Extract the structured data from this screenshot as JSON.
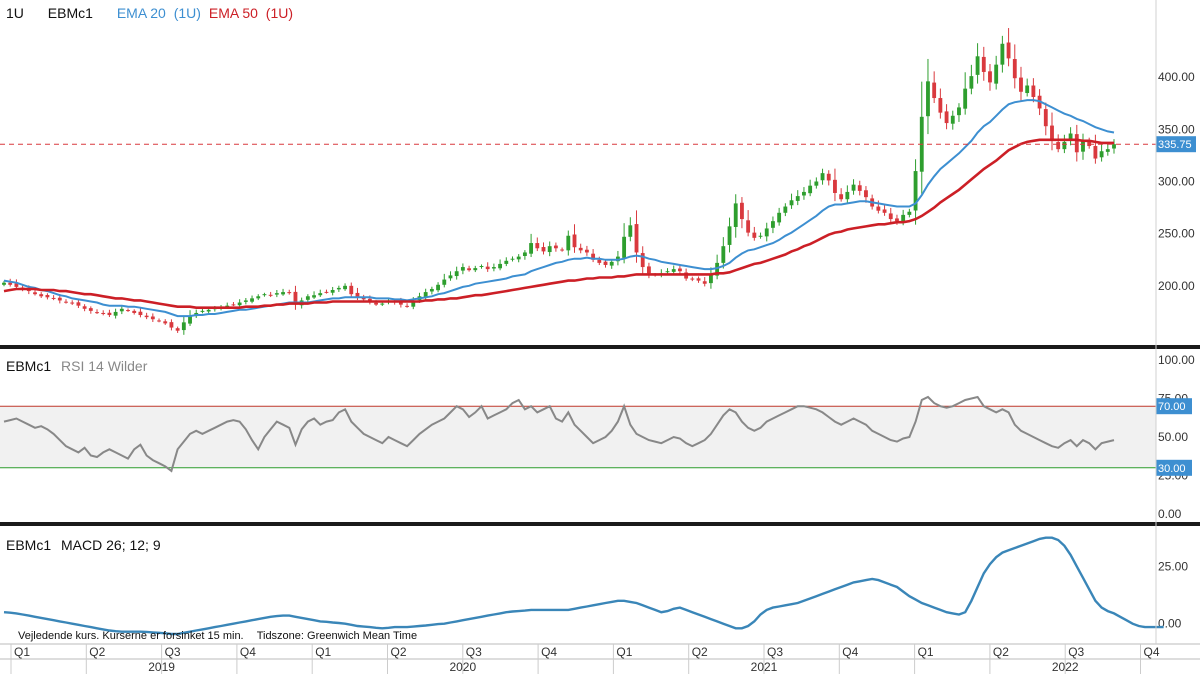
{
  "header": {
    "interval": "1U",
    "symbol": "EBMc1",
    "ema20_label": "EMA 20",
    "ema20_interval": "(1U)",
    "ema50_label": "EMA 50",
    "ema50_interval": "(1U)"
  },
  "rsi_header": {
    "symbol": "EBMc1",
    "label": "RSI 14 Wilder"
  },
  "macd_header": {
    "symbol": "EBMc1",
    "label": "MACD 26; 12; 9"
  },
  "disclaimer": "Vejledende kurs. Kurserne er forsinket 15 min.",
  "timezone": "Tidszone: Greenwich Mean Time",
  "colors": {
    "up": "#2e9e2e",
    "down": "#d9393e",
    "ema20": "#3d8fd1",
    "ema50": "#cc1f26",
    "rsi": "#888888",
    "macd": "#3a86b8",
    "band": "#f1f1f1",
    "rsi_upper": "#c0392b",
    "rsi_lower": "#2e9e2e",
    "last_price_box": "#3d8fd1"
  },
  "chart_data": [
    {
      "type": "candlestick",
      "ylim": [
        150,
        450
      ],
      "yticks": [
        "400.00",
        "350.00",
        "300.00",
        "250.00",
        "200.00"
      ],
      "ytick_values": [
        400,
        350,
        300,
        250,
        200
      ],
      "last_price": 335.75,
      "last_price_label": "335.75",
      "close": [
        203,
        201,
        199,
        197,
        195,
        192,
        190,
        189,
        188,
        186,
        184,
        183,
        181,
        178,
        176,
        174,
        173,
        172,
        175,
        178,
        176,
        174,
        172,
        170,
        168,
        166,
        164,
        160,
        157,
        165,
        171,
        174,
        176,
        177,
        179,
        180,
        181,
        182,
        184,
        186,
        188,
        190,
        192,
        191,
        193,
        194,
        193,
        182,
        186,
        190,
        191,
        193,
        194,
        196,
        198,
        200,
        192,
        189,
        187,
        185,
        182,
        183,
        186,
        184,
        182,
        180,
        185,
        190,
        194,
        197,
        201,
        206,
        210,
        214,
        218,
        215,
        217,
        219,
        216,
        218,
        221,
        224,
        226,
        228,
        232,
        241,
        236,
        233,
        238,
        236,
        234,
        248,
        237,
        234,
        232,
        225,
        222,
        220,
        223,
        228,
        247,
        258,
        232,
        218,
        212,
        210,
        212,
        214,
        216,
        214,
        207,
        206,
        205,
        202,
        211,
        222,
        238,
        257,
        279,
        264,
        251,
        246,
        248,
        255,
        262,
        270,
        276,
        282,
        286,
        290,
        296,
        300,
        308,
        301,
        289,
        283,
        290,
        297,
        291,
        285,
        276,
        272,
        270,
        264,
        262,
        268,
        271,
        310,
        362,
        396,
        380,
        366,
        356,
        363,
        371,
        389,
        401,
        420,
        405,
        395,
        412,
        432,
        418,
        399,
        386,
        392,
        381,
        370,
        353,
        339,
        331,
        338,
        346,
        328,
        340,
        334,
        322,
        329,
        331,
        335.75
      ],
      "series": [
        {
          "name": "EMA 20",
          "values": [
            205,
            204,
            203,
            201,
            199,
            198,
            196,
            195,
            193,
            191,
            190,
            188,
            187,
            186,
            185,
            184,
            182,
            181,
            181,
            181,
            180,
            180,
            179,
            178,
            177,
            176,
            175,
            173,
            171,
            171,
            171,
            172,
            172,
            173,
            173,
            174,
            175,
            176,
            177,
            177,
            178,
            179,
            180,
            181,
            182,
            183,
            184,
            184,
            184,
            184,
            185,
            186,
            187,
            188,
            188,
            189,
            189,
            189,
            189,
            189,
            188,
            188,
            188,
            187,
            187,
            186,
            187,
            188,
            189,
            190,
            192,
            193,
            195,
            197,
            199,
            200,
            202,
            203,
            204,
            205,
            206,
            207,
            209,
            210,
            211,
            214,
            216,
            218,
            220,
            222,
            223,
            225,
            226,
            226,
            227,
            226,
            226,
            225,
            225,
            225,
            226,
            228,
            229,
            228,
            226,
            225,
            223,
            222,
            221,
            220,
            219,
            218,
            217,
            216,
            216,
            217,
            219,
            222,
            227,
            231,
            234,
            235,
            237,
            239,
            241,
            244,
            248,
            251,
            255,
            259,
            263,
            267,
            272,
            276,
            278,
            278,
            279,
            280,
            281,
            281,
            280,
            279,
            278,
            277,
            276,
            276,
            276,
            279,
            287,
            297,
            305,
            312,
            317,
            322,
            327,
            333,
            339,
            347,
            353,
            357,
            363,
            369,
            374,
            376,
            377,
            378,
            378,
            377,
            374,
            371,
            368,
            365,
            363,
            360,
            358,
            355,
            352,
            350,
            348,
            347
          ]
        },
        {
          "name": "EMA 50",
          "values": [
            195,
            196,
            197,
            197,
            197,
            197,
            196,
            196,
            196,
            195,
            195,
            194,
            193,
            192,
            192,
            191,
            190,
            189,
            188,
            188,
            187,
            186,
            186,
            185,
            184,
            183,
            182,
            181,
            180,
            180,
            180,
            179,
            179,
            179,
            179,
            179,
            179,
            179,
            179,
            180,
            180,
            180,
            181,
            181,
            182,
            182,
            183,
            183,
            183,
            183,
            184,
            184,
            184,
            185,
            185,
            185,
            185,
            185,
            185,
            185,
            185,
            185,
            185,
            185,
            185,
            185,
            185,
            185,
            186,
            186,
            187,
            187,
            188,
            188,
            189,
            190,
            191,
            191,
            192,
            193,
            194,
            195,
            196,
            197,
            198,
            199,
            200,
            201,
            202,
            203,
            204,
            205,
            205,
            206,
            207,
            207,
            208,
            208,
            208,
            209,
            209,
            210,
            211,
            211,
            211,
            211,
            211,
            211,
            211,
            211,
            211,
            211,
            211,
            211,
            211,
            212,
            212,
            213,
            215,
            217,
            219,
            221,
            222,
            224,
            226,
            228,
            230,
            233,
            235,
            238,
            240,
            243,
            246,
            249,
            251,
            252,
            254,
            255,
            256,
            257,
            258,
            259,
            259,
            260,
            261,
            261,
            262,
            264,
            267,
            271,
            275,
            280,
            284,
            288,
            292,
            297,
            302,
            307,
            312,
            316,
            320,
            325,
            330,
            333,
            336,
            338,
            339,
            340,
            340,
            340,
            340,
            340,
            340,
            340,
            339,
            339,
            338,
            337,
            337,
            337
          ]
        }
      ]
    },
    {
      "type": "line",
      "name": "RSI 14 Wilder",
      "ylim": [
        0,
        100
      ],
      "yticks": [
        "100.00",
        "75.00",
        "50.00",
        "25.00",
        "0.00"
      ],
      "ytick_values": [
        100,
        75,
        50,
        25,
        0
      ],
      "levels": [
        70,
        30
      ],
      "level_labels": [
        "70.00",
        "30.00"
      ],
      "values": [
        60,
        61,
        62,
        60,
        58,
        56,
        57,
        55,
        52,
        48,
        44,
        42,
        40,
        43,
        38,
        37,
        40,
        42,
        40,
        38,
        36,
        42,
        45,
        38,
        35,
        33,
        31,
        28,
        42,
        47,
        52,
        54,
        52,
        54,
        56,
        58,
        60,
        61,
        60,
        55,
        48,
        42,
        50,
        55,
        60,
        58,
        56,
        45,
        55,
        60,
        62,
        58,
        60,
        61,
        66,
        68,
        60,
        56,
        52,
        50,
        48,
        46,
        50,
        48,
        46,
        44,
        48,
        52,
        55,
        58,
        60,
        62,
        66,
        70,
        68,
        63,
        66,
        70,
        62,
        64,
        66,
        68,
        72,
        74,
        68,
        70,
        66,
        68,
        70,
        62,
        60,
        66,
        58,
        54,
        50,
        46,
        48,
        50,
        54,
        60,
        70,
        58,
        52,
        50,
        48,
        47,
        46,
        48,
        50,
        49,
        46,
        44,
        46,
        48,
        52,
        58,
        64,
        68,
        66,
        60,
        56,
        54,
        56,
        60,
        62,
        64,
        66,
        68,
        70,
        70,
        69,
        68,
        66,
        63,
        60,
        58,
        60,
        62,
        60,
        58,
        54,
        52,
        50,
        48,
        47,
        49,
        50,
        60,
        74,
        76,
        72,
        70,
        69,
        70,
        72,
        74,
        75,
        76,
        70,
        68,
        66,
        68,
        66,
        58,
        54,
        52,
        50,
        48,
        46,
        44,
        43,
        46,
        48,
        44,
        48,
        46,
        42,
        46,
        47,
        48
      ]
    },
    {
      "type": "line",
      "name": "MACD 26; 12; 9",
      "ylim": [
        -8,
        40
      ],
      "yticks": [
        "25.00",
        "0.00"
      ],
      "ytick_values": [
        25,
        0
      ],
      "values": [
        5,
        4.8,
        4.5,
        4,
        3.5,
        3,
        2.5,
        2,
        1.5,
        1,
        0.5,
        0,
        -0.5,
        -1,
        -1.5,
        -2,
        -2.5,
        -3,
        -3.3,
        -3.5,
        -3.5,
        -3.5,
        -3.5,
        -3.6,
        -3.8,
        -4,
        -4.2,
        -4.5,
        -4.5,
        -4,
        -3.5,
        -3,
        -2.5,
        -2,
        -1.5,
        -1,
        -0.5,
        0,
        0.5,
        1,
        1.5,
        2,
        2.5,
        3,
        3.3,
        3.5,
        3.5,
        3,
        2.5,
        2,
        1.5,
        1,
        0.8,
        0.5,
        0.3,
        0,
        -0.5,
        -1,
        -1.3,
        -1.5,
        -1.8,
        -2,
        -1.8,
        -1.5,
        -1.5,
        -1.5,
        -1.3,
        -1,
        -0.8,
        -0.5,
        -0.2,
        0,
        0.5,
        1,
        1.5,
        2,
        2.5,
        3,
        3.5,
        4,
        4.5,
        5,
        5.3,
        5.5,
        5.7,
        6,
        6,
        6,
        6,
        6,
        6,
        6,
        6.5,
        7,
        7.5,
        8,
        8.5,
        9,
        9.5,
        10,
        10,
        9.5,
        9,
        8,
        7,
        6,
        5,
        5.5,
        6.5,
        7,
        6,
        5,
        4,
        3,
        2,
        1,
        0,
        -1,
        -2,
        -2,
        -1,
        1,
        4,
        6,
        7,
        7.5,
        8,
        8.5,
        9,
        10,
        11,
        12,
        13,
        14,
        15,
        16,
        17,
        18,
        18.5,
        19,
        19.5,
        19,
        18,
        17,
        16,
        14,
        12,
        10.5,
        9,
        8,
        7,
        6,
        5,
        4.5,
        4,
        5,
        10,
        16,
        22,
        26,
        29,
        31,
        32,
        33,
        34,
        35,
        36,
        37,
        37.5,
        37.5,
        36.5,
        34,
        30,
        25,
        20,
        15,
        10,
        7,
        5.5,
        4.5,
        3,
        1.5,
        0,
        -1,
        -1.5,
        -1.5,
        -1.5,
        -1.5
      ]
    }
  ],
  "x_axis": {
    "quarters": [
      "Q1",
      "Q2",
      "Q3",
      "Q4",
      "Q1",
      "Q2",
      "Q3",
      "Q4",
      "Q1",
      "Q2",
      "Q3",
      "Q4",
      "Q1",
      "Q2",
      "Q3",
      "Q4"
    ],
    "years": [
      "2019",
      "2020",
      "2021",
      "2022"
    ]
  }
}
